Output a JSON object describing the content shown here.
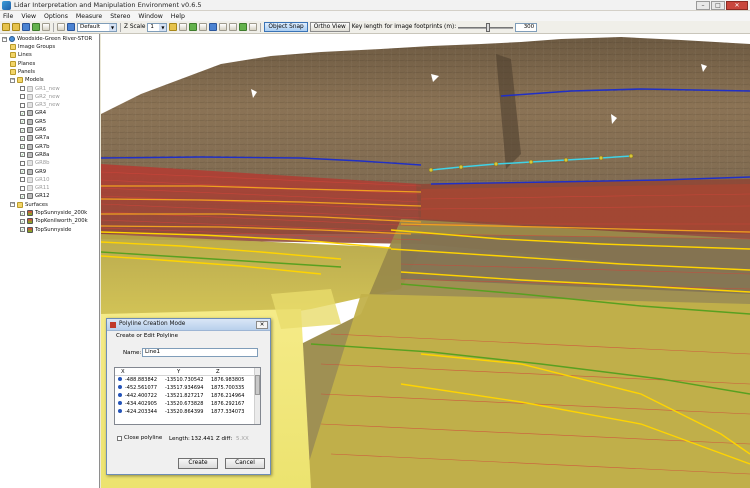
{
  "window": {
    "title": "Lidar Interpretation and Manipulation Environment v0.6.5",
    "minimize": "–",
    "maximize": "□",
    "close": "✕"
  },
  "menu": [
    "File",
    "View",
    "Options",
    "Measure",
    "Stereo",
    "Window",
    "Help"
  ],
  "toolbar": {
    "select_default": "Default",
    "zscale_label": "Z Scale",
    "zscale_value": "1",
    "object_snap": "Object Snap",
    "ortho_view": "Ortho View",
    "key_length_label": "Key length for image footprints (m):",
    "key_length_value": "300",
    "key_length_fraction": 0.55
  },
  "tree": {
    "root": "Woodside-Green River-STOR",
    "items": [
      {
        "label": "Image Groups",
        "type": "folder"
      },
      {
        "label": "Lines",
        "type": "folder"
      },
      {
        "label": "Planes",
        "type": "folder"
      },
      {
        "label": "Panels",
        "type": "folder"
      },
      {
        "label": "Models",
        "type": "folder"
      },
      {
        "label": "GR1_new",
        "type": "model-dim"
      },
      {
        "label": "GR2_new",
        "type": "model-dim"
      },
      {
        "label": "GR3_new",
        "type": "model-dim"
      },
      {
        "label": "GR4",
        "type": "model"
      },
      {
        "label": "GR5",
        "type": "model"
      },
      {
        "label": "GR6",
        "type": "model"
      },
      {
        "label": "GR7a",
        "type": "model"
      },
      {
        "label": "GR7b",
        "type": "model"
      },
      {
        "label": "GR8a",
        "type": "model"
      },
      {
        "label": "GR8b",
        "type": "model-dim"
      },
      {
        "label": "GR9",
        "type": "model"
      },
      {
        "label": "GR10",
        "type": "model-dim"
      },
      {
        "label": "GR11",
        "type": "model-dim"
      },
      {
        "label": "GR12",
        "type": "model"
      },
      {
        "label": "Surfaces",
        "type": "folder"
      },
      {
        "label": "TopSunnyside_200k",
        "type": "surface"
      },
      {
        "label": "TopKenilworth_200k",
        "type": "surface"
      },
      {
        "label": "TopSunnyside",
        "type": "surface"
      }
    ]
  },
  "dialog": {
    "title": "Polyline Creation Mode",
    "close": "✕",
    "subtitle": "Create or Edit Polyline",
    "name_label": "Name:",
    "name_value": "Line1",
    "columns": [
      "X",
      "Y",
      "Z"
    ],
    "points": [
      [
        "-488.883842",
        "-13510.730542",
        "1876.983805"
      ],
      [
        "-452.561077",
        "-13517.934694",
        "1875.700335"
      ],
      [
        "-442.400722",
        "-13521.827217",
        "1876.214964"
      ],
      [
        "-434.402905",
        "-13520.673828",
        "1876.292167"
      ],
      [
        "-424.203344",
        "-13520.864399",
        "1877.334073"
      ]
    ],
    "close_polyline_label": "Close polyline",
    "length_label": "Length:",
    "length_value": "132.441",
    "zdiff_label": "Z diff:",
    "zdiff_value": "5.XX",
    "create_button": "Create",
    "cancel_button": "Cancel"
  }
}
